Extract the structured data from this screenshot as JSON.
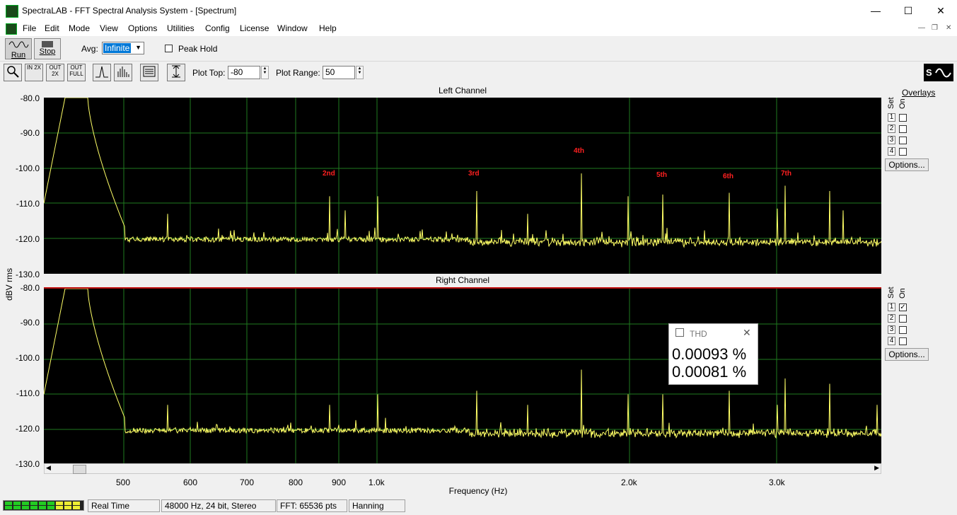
{
  "title": "SpectraLAB - FFT Spectral Analysis System - [Spectrum]",
  "menu": [
    "File",
    "Edit",
    "Mode",
    "View",
    "Options",
    "Utilities",
    "Config",
    "License",
    "Window",
    "Help"
  ],
  "toolbar": {
    "run_label": "Run",
    "stop_label": "Stop",
    "avg_label": "Avg:",
    "avg_value": "Infinite",
    "peak_hold_label": "Peak Hold",
    "plot_top_label": "Plot Top:",
    "plot_top_value": "-80",
    "plot_range_label": "Plot Range:",
    "plot_range_value": "50",
    "zoom_labels": [
      "IN 2X",
      "OUT 2X",
      "OUT FULL"
    ]
  },
  "plots": {
    "left_title": "Left Channel",
    "right_title": "Right Channel",
    "y_axis_label": "dBV rms",
    "x_axis_label": "Frequency (Hz)",
    "y_ticks": [
      "-80.0",
      "-90.0",
      "-100.0",
      "-110.0",
      "-120.0",
      "-130.0"
    ],
    "x_ticks": [
      "500",
      "600",
      "700",
      "800",
      "900",
      "1.0k",
      "2.0k",
      "3.0k"
    ],
    "harmonics": [
      "2nd",
      "3rd",
      "4th",
      "5th",
      "6th",
      "7th"
    ]
  },
  "overlays": {
    "title": "Overlays",
    "set_label": "Set",
    "on_label": "On",
    "numbers": [
      "1",
      "2",
      "3",
      "4"
    ],
    "options_label": "Options..."
  },
  "thd": {
    "title": "THD",
    "left_value": "0.00093 %",
    "right_value": "0.00081 %"
  },
  "status": {
    "mode": "Real Time",
    "format": "48000 Hz, 24 bit, Stereo",
    "fft": "FFT: 65536 pts",
    "window": "Hanning"
  },
  "colors": {
    "trace": "#ffff66",
    "grid": "#1f7a1f",
    "harmonic_label": "#ff2020",
    "selection": "#0078d7"
  }
}
